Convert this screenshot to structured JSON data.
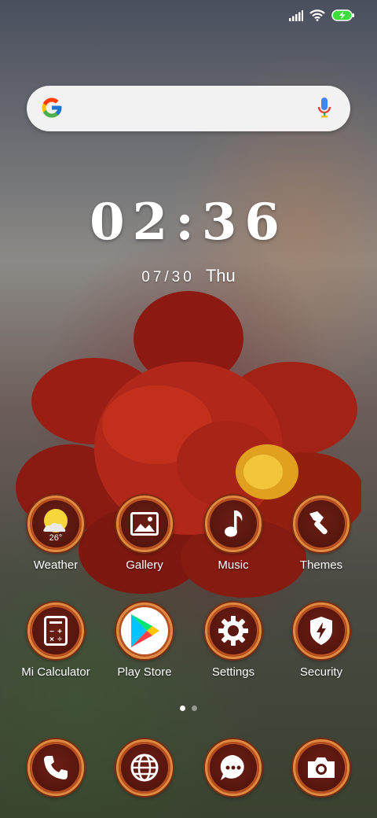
{
  "status_bar": {
    "icons": [
      "signal-icon",
      "wifi-icon",
      "battery-charging-icon"
    ],
    "battery_color": "#3ddc3d"
  },
  "search": {
    "logo": "google-g-icon",
    "mic": "mic-icon"
  },
  "clock": {
    "time": "02:36",
    "date": "07/30",
    "weekday": "Thu"
  },
  "apps_row1": [
    {
      "label": "Weather",
      "icon": "weather-icon",
      "temp": "26°"
    },
    {
      "label": "Gallery",
      "icon": "gallery-icon"
    },
    {
      "label": "Music",
      "icon": "music-note-icon"
    },
    {
      "label": "Themes",
      "icon": "brush-icon"
    }
  ],
  "apps_row2": [
    {
      "label": "Mi Calculator",
      "icon": "calculator-icon"
    },
    {
      "label": "Play Store",
      "icon": "play-store-icon"
    },
    {
      "label": "Settings",
      "icon": "gear-icon"
    },
    {
      "label": "Security",
      "icon": "shield-icon"
    }
  ],
  "dock": [
    {
      "icon": "phone-icon"
    },
    {
      "icon": "browser-globe-icon"
    },
    {
      "icon": "messages-icon"
    },
    {
      "icon": "camera-icon"
    }
  ],
  "pager": {
    "pages": 2,
    "current": 1
  },
  "colors": {
    "icon_ring": "#e08a40",
    "icon_fill": "#5a170f",
    "accent_sun": "#f7d63c"
  }
}
